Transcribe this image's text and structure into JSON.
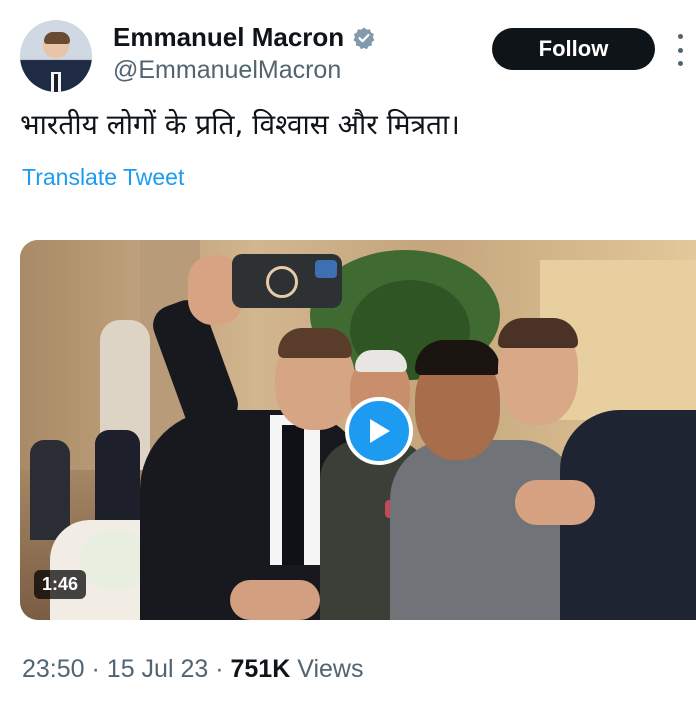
{
  "author": {
    "name": "Emmanuel Macron",
    "handle": "@EmmanuelMacron",
    "verified": true,
    "verified_icon": "verified-badge-icon"
  },
  "follow_button": {
    "label": "Follow"
  },
  "more_menu": {
    "icon": "more-vertical-icon"
  },
  "tweet": {
    "text": "भारतीय लोगों के प्रति, विश्वास और मित्रता।",
    "translate_label": "Translate Tweet"
  },
  "media": {
    "type": "video",
    "duration": "1:46",
    "play_icon": "play-icon"
  },
  "meta": {
    "time": "23:50",
    "date": "15 Jul 23",
    "views_count": "751K",
    "views_label": "Views",
    "separator": "·"
  },
  "colors": {
    "accent": "#1d9bf0",
    "text_primary": "#0f1419",
    "text_secondary": "#536471",
    "button_bg": "#0f1419"
  }
}
